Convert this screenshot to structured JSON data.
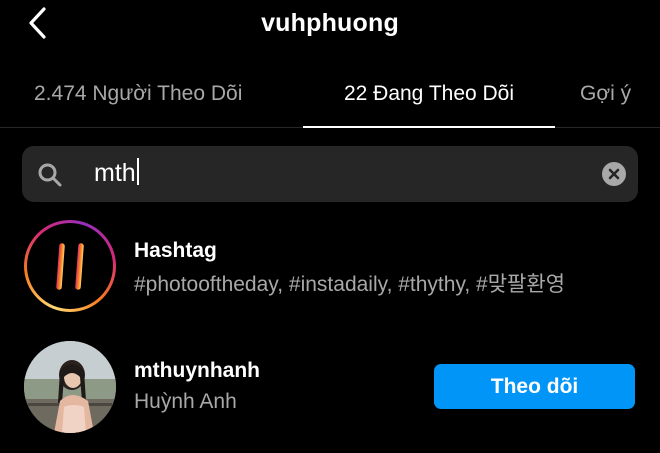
{
  "header": {
    "title": "vuhphuong",
    "back_icon": "chevron-left-icon"
  },
  "tabs": [
    {
      "label": "2.474 Người Theo Dõi",
      "active": false
    },
    {
      "label": "22 Đang Theo Dõi",
      "active": true
    },
    {
      "label": "Gợi ý",
      "active": false
    }
  ],
  "search": {
    "value": "mth",
    "search_icon": "search-icon",
    "clear_icon": "clear-icon"
  },
  "results": [
    {
      "type": "hashtag",
      "title": "Hashtag",
      "subtitle": "#photooftheday, #instadaily, #thythy, #맞팔환영",
      "icon": "hashtag-icon"
    },
    {
      "type": "user",
      "username": "mthuynhanh",
      "full_name": "Huỳnh Anh",
      "action_label": "Theo dõi",
      "action_color": "#0095f6"
    }
  ],
  "colors": {
    "background": "#000000",
    "secondary_text": "#a8a8a8",
    "search_bg": "#262626",
    "accent": "#0095f6"
  }
}
